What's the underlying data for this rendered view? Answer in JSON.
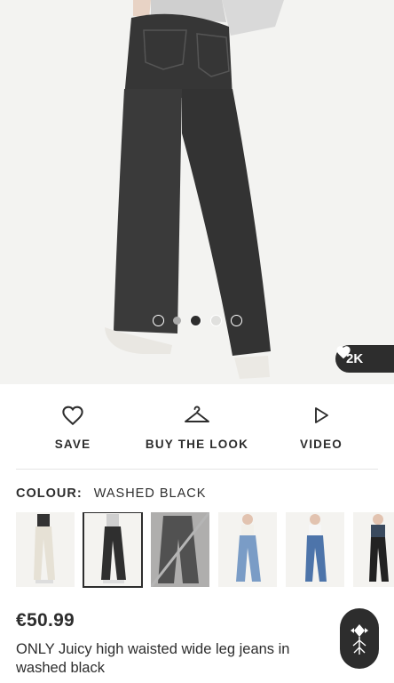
{
  "gallery": {
    "image_alt": "Model wearing washed black wide leg jeans, back view",
    "pager_dots": 5,
    "active_dot": 3,
    "likes_count": "2K"
  },
  "actions": {
    "save_label": "SAVE",
    "buy_the_look_label": "BUY THE LOOK",
    "video_label": "VIDEO"
  },
  "colour": {
    "label": "COLOUR:",
    "value": "WASHED BLACK",
    "swatches": [
      "cream",
      "washed black",
      "charcoal",
      "mid blue",
      "blue",
      "black"
    ],
    "selected_index": 1,
    "unavailable_index": 2
  },
  "product": {
    "price": "€50.99",
    "title": "ONLY Juicy high waisted wide leg jeans in washed black"
  },
  "colors": {
    "text": "#2d2d2d",
    "denim_black": "#3a3a3a",
    "background": "#ffffff"
  }
}
